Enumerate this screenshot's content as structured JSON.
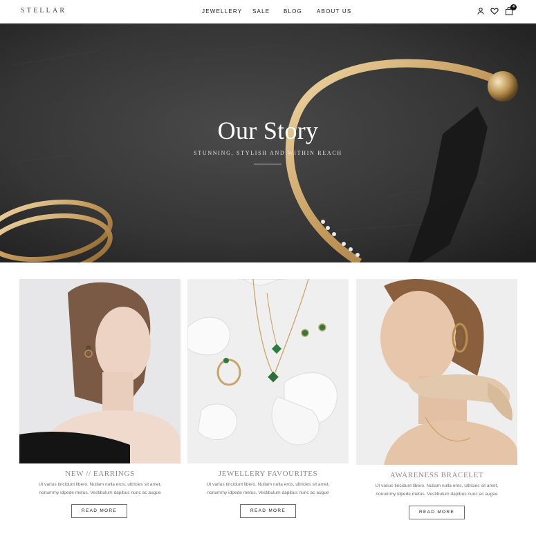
{
  "header": {
    "logo": "STELLAR",
    "nav": [
      "JEWELLERY",
      "SALE",
      "BLOG",
      "ABOUT US"
    ],
    "icons": [
      "user-icon",
      "heart-icon",
      "shopping-bag-icon"
    ],
    "cart_count": "4"
  },
  "hero": {
    "title": "Our Story",
    "subtitle": "STUNNING, STYLISH AND WITHIN REACH"
  },
  "cards": [
    {
      "title": "NEW // EARRINGS",
      "text_line1": "Ut varius tincidunt libero. Nullam nulla eros, ultricies sit amet,",
      "text_line2": "nonummy idpede metus. Vestibulum dapibus nunc ac augue",
      "button": "READ MORE"
    },
    {
      "title": "JEWELLERY FAVOURITES",
      "text_line1": "Ut varius tincidunt libero. Nullam nulla eros, ultricies sit amet,",
      "text_line2": "nonummy idpede metus. Vestibulum dapibus nunc ac augue",
      "button": "READ MORE"
    },
    {
      "title": "AWARENESS BRACELET",
      "text_line1": "Ut varius tincidunt libero. Nullam nulla eros, ultricies sit amet,",
      "text_line2": "nonummy idpede metus. Vestibulum dapibus nunc ac augue",
      "button": "READ MORE"
    }
  ],
  "colors": {
    "text_dark": "#222222",
    "muted_title": "#8a8a8a",
    "hero_bg": "#2b2b2b",
    "gold": "#c9a46a"
  }
}
